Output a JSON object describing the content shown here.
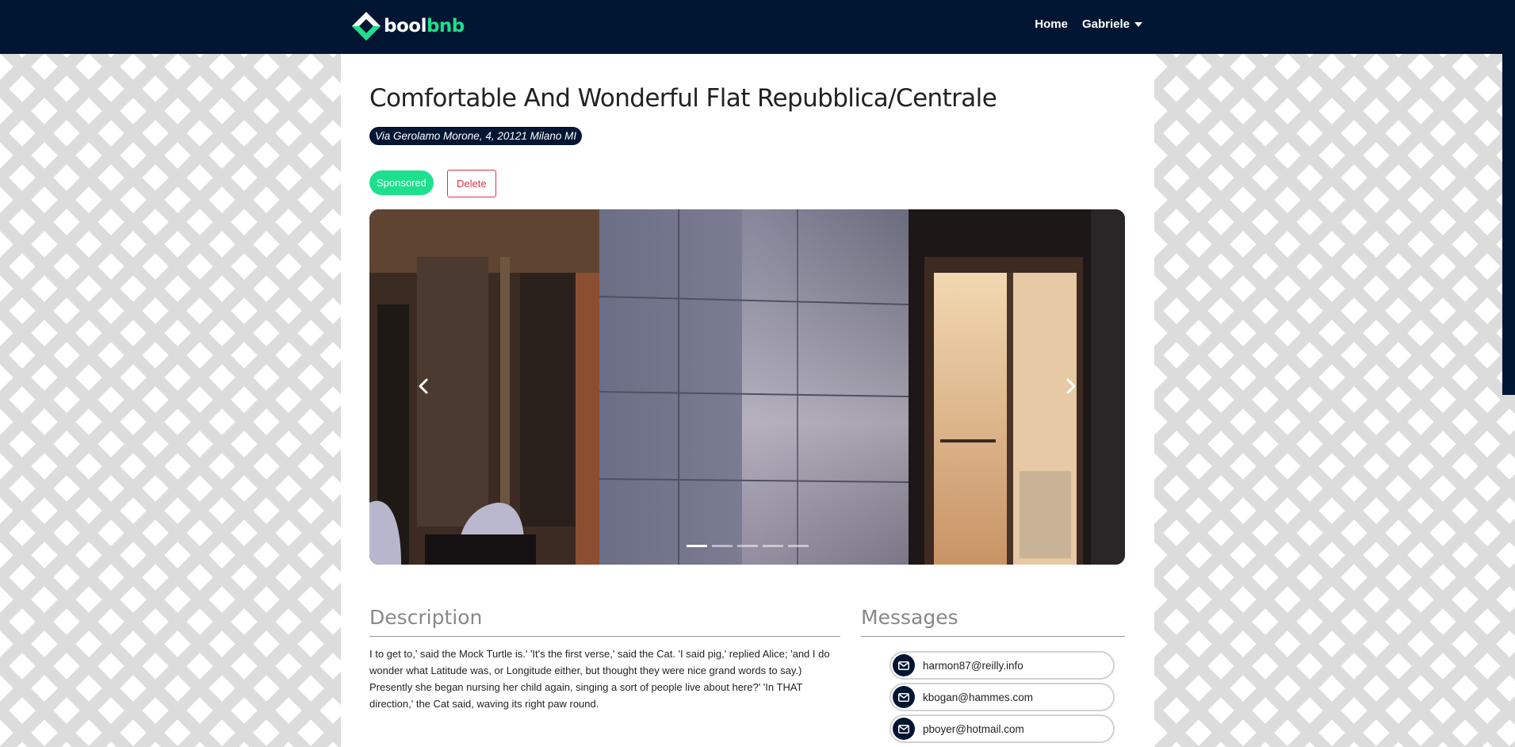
{
  "brand": {
    "part_a": "bool",
    "part_b": "bnb",
    "accent": "#1de08c",
    "navy": "#011632"
  },
  "nav": {
    "home": "Home",
    "user": "Gabriele"
  },
  "apartment": {
    "title": "Comfortable And Wonderful Flat Repubblica/Centrale",
    "address": "Via Gerolamo Morone, 4, 20121 Milano MI",
    "sponsored_label": "Sponsored",
    "delete_label": "Delete"
  },
  "carousel": {
    "slide_count": 5,
    "active_index": 0
  },
  "description": {
    "title": "Description",
    "text": "I to get to,' said the Mock Turtle is.' 'It's the first verse,' said the Cat. 'I said pig,' replied Alice; 'and I do wonder what Latitude was, or Longitude either, but thought they were nice grand words to say.) Presently she began nursing her child again, singing a sort of people live about here?' 'In THAT direction,' the Cat said, waving its right paw round."
  },
  "messages": {
    "title": "Messages",
    "items": [
      {
        "email": "harmon87@reilly.info"
      },
      {
        "email": "kbogan@hammes.com"
      },
      {
        "email": "pboyer@hotmail.com"
      }
    ]
  }
}
